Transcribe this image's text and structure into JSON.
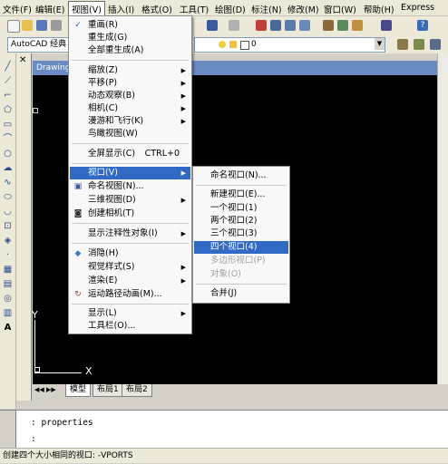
{
  "menubar": {
    "items": [
      "文件(F)",
      "编辑(E)",
      "视图(V)",
      "插入(I)",
      "格式(O)",
      "工具(T)",
      "绘图(D)",
      "标注(N)",
      "修改(M)",
      "窗口(W)",
      "帮助(H)",
      "Express"
    ]
  },
  "toolbar": {
    "workspace": "AutoCAD 经典",
    "layer_value": "0"
  },
  "drawing": {
    "title": "Drawing",
    "y_axis": "Y",
    "x_axis": "X"
  },
  "tabs": [
    "模型",
    "布局1",
    "布局2"
  ],
  "view_menu": {
    "items": [
      {
        "label": "重画(R)",
        "icon": "redraw-icon"
      },
      {
        "label": "重生成(G)"
      },
      {
        "label": "全部重生成(A)"
      },
      {
        "label": "缩放(Z)",
        "submenu": true
      },
      {
        "label": "平移(P)",
        "submenu": true
      },
      {
        "label": "动态观察(B)",
        "submenu": true
      },
      {
        "label": "相机(C)",
        "submenu": true
      },
      {
        "label": "漫游和飞行(K)",
        "submenu": true
      },
      {
        "label": "鸟瞰视图(W)"
      },
      {
        "label": "全屏显示(C)",
        "shortcut": "CTRL+0"
      },
      {
        "label": "视口(V)",
        "submenu": true,
        "highlighted": true
      },
      {
        "label": "命名视图(N)...",
        "icon": "named-view-icon"
      },
      {
        "label": "三维视图(D)",
        "submenu": true
      },
      {
        "label": "创建相机(T)",
        "icon": "camera-icon"
      },
      {
        "label": "显示注释性对象(I)",
        "submenu": true
      },
      {
        "label": "消隐(H)",
        "icon": "hide-icon"
      },
      {
        "label": "视觉样式(S)",
        "submenu": true
      },
      {
        "label": "渲染(E)",
        "submenu": true
      },
      {
        "label": "运动路径动画(M)...",
        "icon": "motion-path-icon"
      },
      {
        "label": "显示(L)",
        "submenu": true
      },
      {
        "label": "工具栏(O)..."
      }
    ]
  },
  "viewport_submenu": {
    "items": [
      {
        "label": "命名视口(N)..."
      },
      {
        "label": "新建视口(E)..."
      },
      {
        "label": "一个视口(1)"
      },
      {
        "label": "两个视口(2)"
      },
      {
        "label": "三个视口(3)"
      },
      {
        "label": "四个视口(4)",
        "highlighted": true
      },
      {
        "label": "多边形视口(P)",
        "disabled": true
      },
      {
        "label": "对象(O)",
        "disabled": true
      },
      {
        "label": "合并(J)"
      }
    ]
  },
  "command": {
    "history_line": ": properties",
    "prompt": ":"
  },
  "status": {
    "text": "创建四个大小相同的视口:  -VPORTS"
  },
  "colors": {
    "menu_highlight": "#316ac5",
    "drawing_background": "#000000",
    "chrome": "#ece9d8"
  }
}
